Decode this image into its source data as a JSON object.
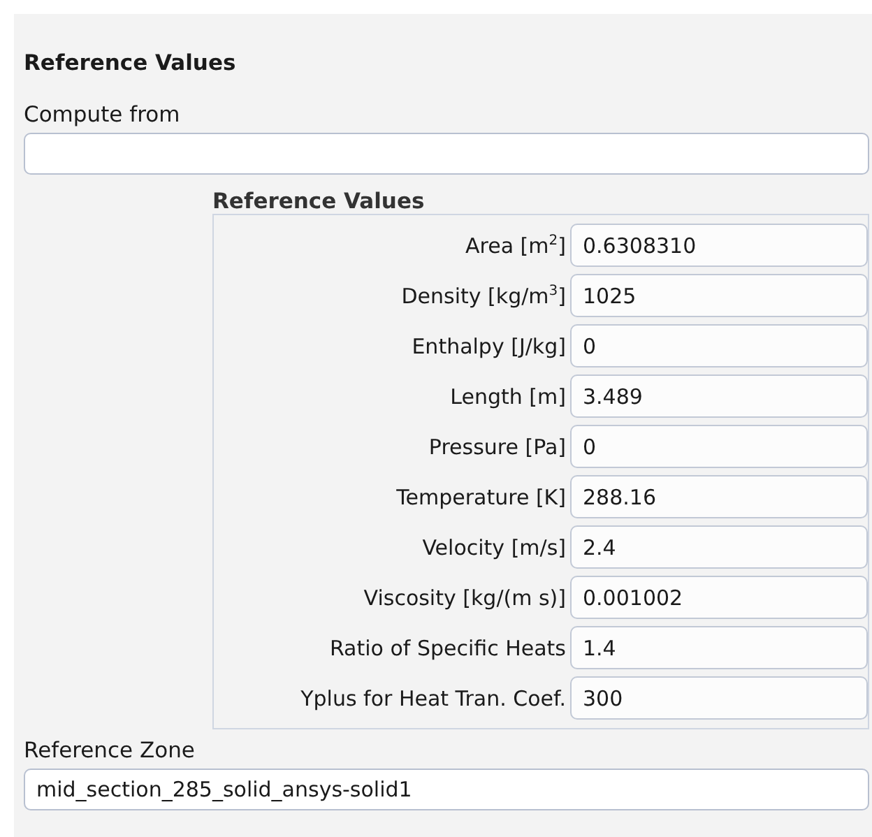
{
  "heading": "Reference Values",
  "compute_from": {
    "label": "Compute from"
  },
  "reference_values": {
    "title": "Reference Values",
    "fields": [
      {
        "label": "Area [m$^{2}$]",
        "value": "0.6308310"
      },
      {
        "label": "Density [kg/m$^{3}$]",
        "value": "1025"
      },
      {
        "label": "Enthalpy [J/kg]",
        "value": "0"
      },
      {
        "label": "Length [m]",
        "value": "3.489"
      },
      {
        "label": "Pressure [Pa]",
        "value": "0"
      },
      {
        "label": "Temperature [K]",
        "value": "288.16"
      },
      {
        "label": "Velocity [m/s]",
        "value": "2.4"
      },
      {
        "label": "Viscosity [kg/(m s)]",
        "value": "0.001002"
      },
      {
        "label": "Ratio of Specific Heats",
        "value": "1.4"
      },
      {
        "label": "Yplus for Heat Tran. Coef.",
        "value": "300"
      }
    ]
  },
  "reference_zone": {
    "label": "Reference Zone",
    "value": "mid_section_285_solid_ansys-solid1"
  }
}
